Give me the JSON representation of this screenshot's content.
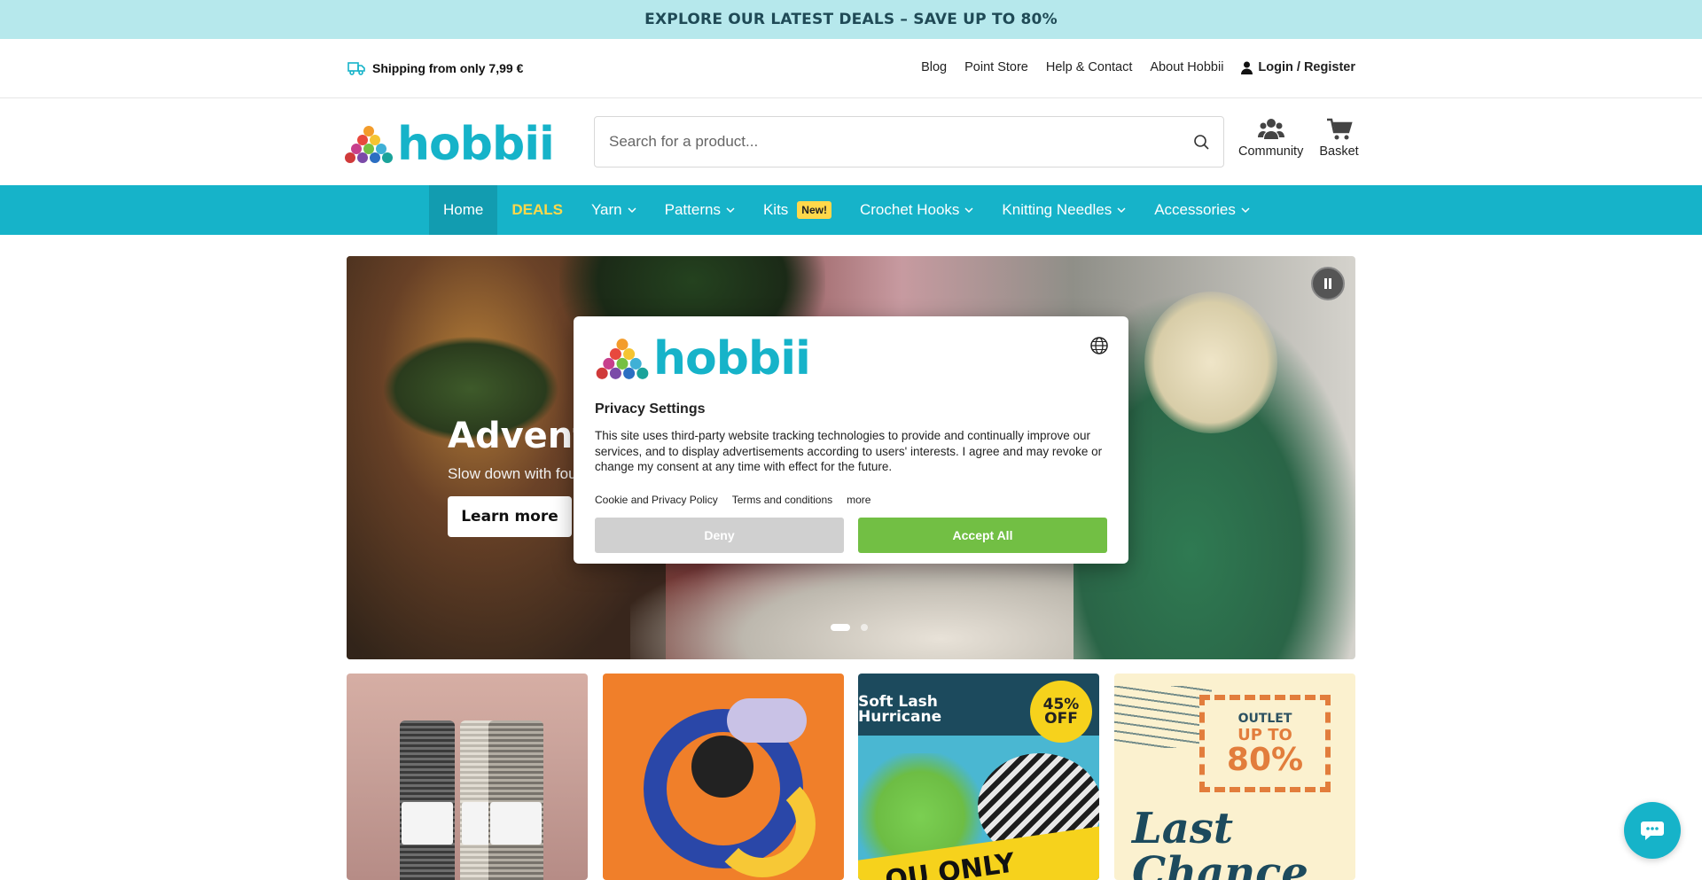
{
  "promo": {
    "text": "EXPLORE OUR LATEST DEALS – SAVE UP TO 80%"
  },
  "utility": {
    "shipping": "Shipping from only 7,99 €",
    "links": [
      "Blog",
      "Point Store",
      "Help & Contact",
      "About Hobbii"
    ],
    "login": "Login / Register"
  },
  "header": {
    "logo_text": "hobbii",
    "search_placeholder": "Search for a product...",
    "community": "Community",
    "basket": "Basket"
  },
  "nav": {
    "items": [
      "Home",
      "DEALS",
      "Yarn",
      "Patterns",
      "Kits",
      "Crochet Hooks",
      "Knitting Needles",
      "Accessories"
    ],
    "kits_badge": "New!"
  },
  "hero": {
    "title": "Advent C",
    "subtitle": "Slow down with fou",
    "button": "Learn more"
  },
  "tiles": {
    "t3_title_1": "Soft Lash",
    "t3_title_2": "Hurricane",
    "t3_badge_1": "45%",
    "t3_badge_2": "OFF",
    "t3_stripe": "OU ONLY",
    "t4_small_1": "OUTLET",
    "t4_small_2": "UP TO",
    "t4_big": "80%",
    "t4_last_1": "Last",
    "t4_last_2": "Chance"
  },
  "modal": {
    "logo_text": "hobbii",
    "title": "Privacy Settings",
    "text": "This site uses third-party website tracking technologies to provide and continually improve our services, and to display advertisements according to users' interests. I agree and may revoke or change my consent at any time with effect for the future.",
    "links": [
      "Cookie and Privacy Policy",
      "Terms and conditions",
      "more"
    ],
    "deny": "Deny",
    "accept": "Accept All"
  },
  "colors": {
    "brand": "#16b3c9",
    "deals": "#ffd84a",
    "accept": "#72bf44",
    "promo_bg": "#b6e8ec"
  },
  "icons": {
    "shipping": "truck-icon",
    "login": "user-icon",
    "search": "search-icon",
    "community": "people-icon",
    "basket": "cart-icon",
    "globe": "globe-icon",
    "pause": "pause-icon",
    "chat": "chat-icon"
  }
}
